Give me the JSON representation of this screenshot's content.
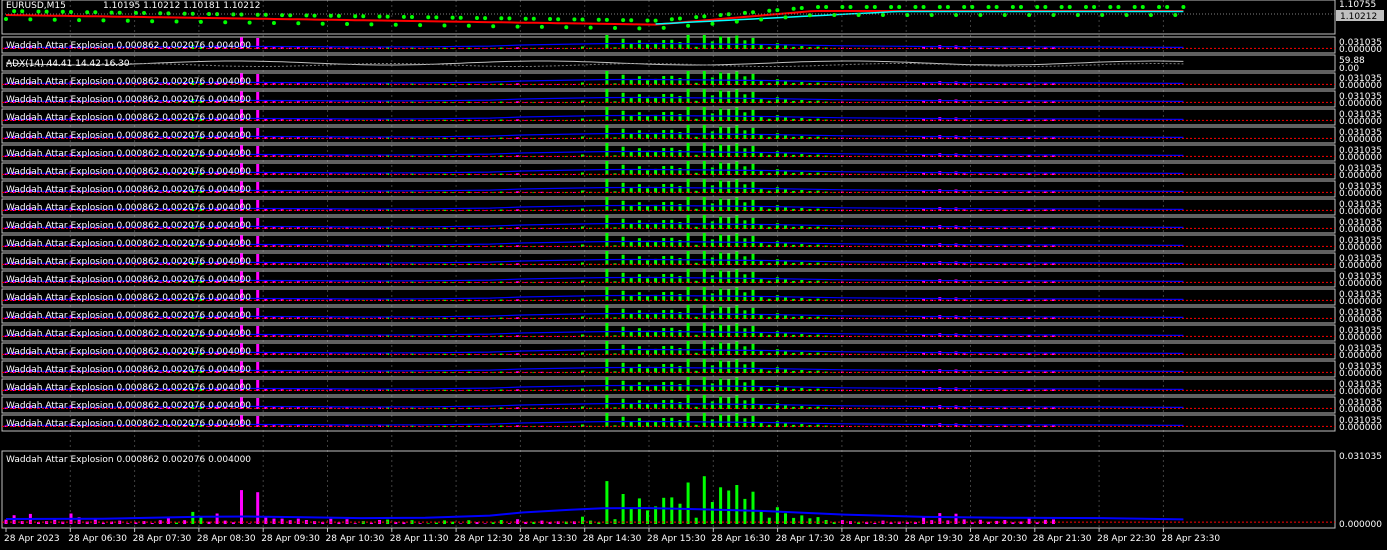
{
  "header": {
    "symbol": "EURUSD,M15",
    "ohlc": "1.10195 1.10212 1.10181 1.10212"
  },
  "price_scale": {
    "top": "1.10755",
    "current": "1.10212"
  },
  "adx": {
    "label": "ADX(14) 44.41 14.42 16.30",
    "scale_top": "59.88",
    "scale_mid": "0.00"
  },
  "wae": {
    "label": "Waddah Attar Explosion 0.000862 0.002076 0.004000",
    "scale_top": "0.031035",
    "scale_bottom": "0.000000",
    "small_panel_count": 20
  },
  "time_axis": [
    "28 Apr 2023",
    "28 Apr 06:30",
    "28 Apr 07:30",
    "28 Apr 08:30",
    "28 Apr 09:30",
    "28 Apr 10:30",
    "28 Apr 11:30",
    "28 Apr 12:30",
    "28 Apr 13:30",
    "28 Apr 14:30",
    "28 Apr 15:30",
    "28 Apr 16:30",
    "28 Apr 17:30",
    "28 Apr 18:30",
    "28 Apr 19:30",
    "28 Apr 20:30",
    "28 Apr 21:30",
    "28 Apr 22:30",
    "28 Apr 23:30"
  ],
  "colors": {
    "background": "#000000",
    "panel_border": "#c0c0c0",
    "grid": "#404040",
    "bull": "#00ff00",
    "bear": "#ff00ff",
    "explosion_line": "#0000ff",
    "dead_zone": "#ff0000",
    "ma_red": "#ff0000",
    "ma_cyan": "#00ffff",
    "price_tag": "#c0c0c0"
  },
  "wae_series": {
    "bars": [
      [
        0.0021,
        0
      ],
      [
        0.0042,
        0
      ],
      [
        0.0014,
        0
      ],
      [
        0.0048,
        0
      ],
      [
        0.0009,
        0
      ],
      [
        0.0014,
        0
      ],
      [
        0.002,
        0
      ],
      [
        0.0012,
        0
      ],
      [
        0.005,
        0
      ],
      [
        0.0032,
        0
      ],
      [
        0.0012,
        0
      ],
      [
        0.0021,
        0
      ],
      [
        0.0006,
        0
      ],
      [
        0.0012,
        0
      ],
      [
        0.0016,
        0
      ],
      [
        0.0004,
        0
      ],
      [
        0.0007,
        0
      ],
      [
        0.0014,
        0
      ],
      [
        0.0005,
        0
      ],
      [
        0.0018,
        0
      ],
      [
        0.0032,
        0
      ],
      [
        0.0006,
        1
      ],
      [
        0.0018,
        0
      ],
      [
        0.0058,
        1
      ],
      [
        0.0032,
        1
      ],
      [
        0.0011,
        0
      ],
      [
        0.005,
        0
      ],
      [
        0.0016,
        0
      ],
      [
        0.0008,
        0
      ],
      [
        0.0162,
        0
      ],
      [
        0.0003,
        0
      ],
      [
        0.0152,
        0
      ],
      [
        0.0038,
        0
      ],
      [
        0.0026,
        0
      ],
      [
        0.0026,
        0
      ],
      [
        0.0018,
        0
      ],
      [
        0.0026,
        0
      ],
      [
        0.0019,
        0
      ],
      [
        0.0014,
        0
      ],
      [
        0.001,
        0
      ],
      [
        0.0025,
        0
      ],
      [
        0.0008,
        0
      ],
      [
        0.0023,
        0
      ],
      [
        0.0004,
        0
      ],
      [
        0.0014,
        1
      ],
      [
        0.0006,
        0
      ],
      [
        0.0019,
        0
      ],
      [
        0.0021,
        1
      ],
      [
        0.0009,
        0
      ],
      [
        0.0008,
        0
      ],
      [
        0.0018,
        1
      ],
      [
        0.0004,
        0
      ],
      [
        0.0003,
        1
      ],
      [
        0.0006,
        1
      ],
      [
        0.0017,
        1
      ],
      [
        0.0011,
        1
      ],
      [
        0.0002,
        0
      ],
      [
        0.0018,
        1
      ],
      [
        0.0009,
        0
      ],
      [
        0.0002,
        0
      ],
      [
        0.0008,
        1
      ],
      [
        0.0019,
        1
      ],
      [
        0.0004,
        0
      ],
      [
        0.0023,
        0
      ],
      [
        0.001,
        0
      ],
      [
        0.001,
        1
      ],
      [
        0.0016,
        0
      ],
      [
        0.001,
        0
      ],
      [
        0.0013,
        0
      ],
      [
        0.0012,
        1
      ],
      [
        0.0013,
        0
      ],
      [
        0.0035,
        1
      ],
      [
        0.0016,
        1
      ],
      [
        0.0008,
        1
      ],
      [
        0.0205,
        1
      ],
      [
        0.0023,
        1
      ],
      [
        0.0143,
        1
      ],
      [
        0.0074,
        1
      ],
      [
        0.0122,
        1
      ],
      [
        0.0065,
        1
      ],
      [
        0.0084,
        1
      ],
      [
        0.0125,
        1
      ],
      [
        0.0127,
        1
      ],
      [
        0.0097,
        1
      ],
      [
        0.0198,
        1
      ],
      [
        0.003,
        1
      ],
      [
        0.0228,
        1
      ],
      [
        0.0105,
        1
      ],
      [
        0.0175,
        1
      ],
      [
        0.016,
        1
      ],
      [
        0.0186,
        1
      ],
      [
        0.012,
        1
      ],
      [
        0.0154,
        1
      ],
      [
        0.0067,
        1
      ],
      [
        0.003,
        1
      ],
      [
        0.008,
        1
      ],
      [
        0.0051,
        1
      ],
      [
        0.0029,
        1
      ],
      [
        0.0041,
        1
      ],
      [
        0.0027,
        1
      ],
      [
        0.0033,
        1
      ],
      [
        0.0019,
        1
      ],
      [
        0.0009,
        1
      ],
      [
        0.0018,
        0
      ],
      [
        0.0014,
        0
      ],
      [
        0.0008,
        1
      ],
      [
        0.001,
        0
      ],
      [
        0.0005,
        0
      ],
      [
        0.0016,
        0
      ],
      [
        0.0007,
        0
      ],
      [
        0.0012,
        0
      ],
      [
        0.0009,
        0
      ],
      [
        0.0009,
        0
      ],
      [
        0.0033,
        0
      ],
      [
        0.0018,
        0
      ],
      [
        0.0052,
        0
      ],
      [
        0.0017,
        0
      ],
      [
        0.0049,
        0
      ],
      [
        0.0022,
        0
      ],
      [
        0.0008,
        0
      ],
      [
        0.002,
        0
      ],
      [
        0.0011,
        0
      ],
      [
        0.0015,
        0
      ],
      [
        0.0019,
        0
      ],
      [
        0.0008,
        0
      ],
      [
        0.0012,
        0
      ],
      [
        0.0029,
        0
      ],
      [
        0.0008,
        0
      ],
      [
        0.002,
        0
      ],
      [
        0.0022,
        0
      ]
    ],
    "explosion": [
      [
        0,
        0.0024
      ],
      [
        30,
        0.0025
      ],
      [
        45,
        0.003
      ],
      [
        60,
        0.0035
      ],
      [
        75,
        0.0036
      ],
      [
        90,
        0.0033
      ],
      [
        110,
        0.0028
      ],
      [
        130,
        0.003
      ],
      [
        150,
        0.004
      ],
      [
        160,
        0.0055
      ],
      [
        175,
        0.0068
      ],
      [
        185,
        0.0075
      ],
      [
        200,
        0.0076
      ],
      [
        215,
        0.007
      ],
      [
        235,
        0.0062
      ],
      [
        260,
        0.0045
      ],
      [
        285,
        0.0034
      ],
      [
        310,
        0.003
      ],
      [
        340,
        0.0028
      ],
      [
        365,
        0.0022
      ]
    ],
    "dead_zone": 0.0009
  }
}
